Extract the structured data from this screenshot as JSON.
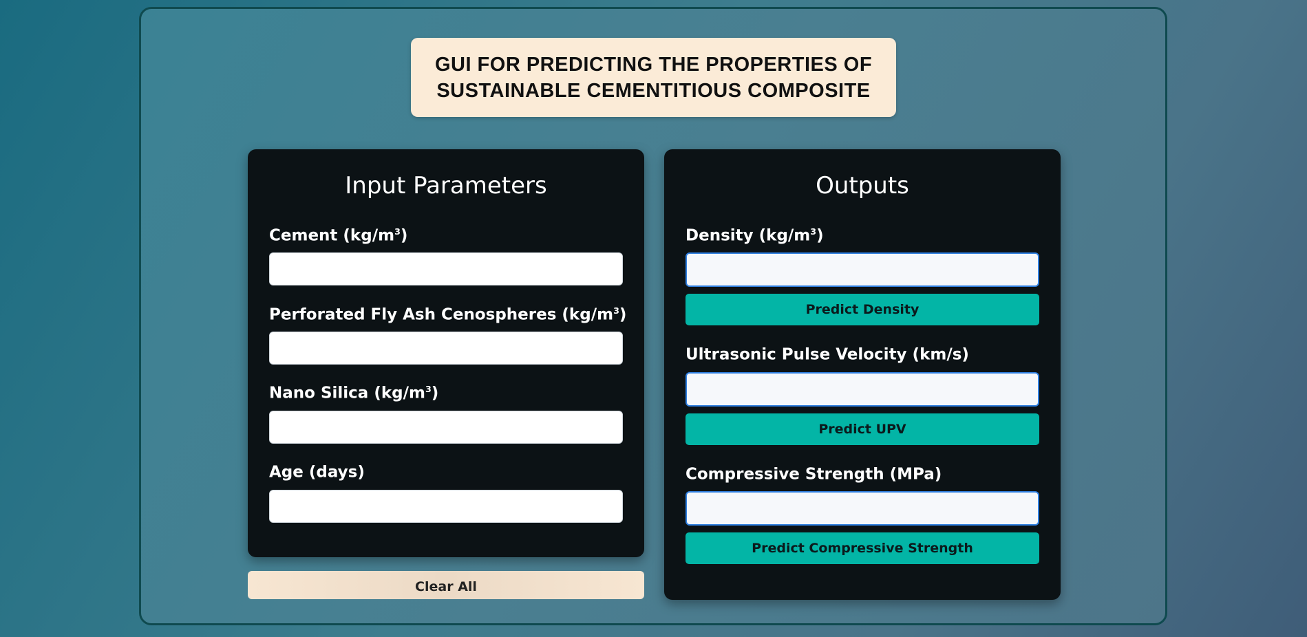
{
  "header": {
    "title": "GUI FOR PREDICTING THE PROPERTIES OF\nSUSTAINABLE CEMENTITIOUS COMPOSITE"
  },
  "input_panel": {
    "heading": "Input Parameters",
    "fields": [
      {
        "label_main": "Cement (kg/m",
        "label_sup": "3",
        "label_end": ")",
        "value": ""
      },
      {
        "label_main": "Perforated Fly Ash Cenospheres (kg/m",
        "label_sup": "3",
        "label_end": ")",
        "value": ""
      },
      {
        "label_main": "Nano Silica (kg/m",
        "label_sup": "3",
        "label_end": ")",
        "value": ""
      },
      {
        "label_main": "Age (days)",
        "label_sup": "",
        "label_end": "",
        "value": ""
      }
    ]
  },
  "output_panel": {
    "heading": "Outputs",
    "fields": [
      {
        "label_main": "Density (kg/m",
        "label_sup": "3",
        "label_end": ")",
        "value": "",
        "button": "Predict Density"
      },
      {
        "label_main": "Ultrasonic Pulse Velocity (km/s)",
        "label_sup": "",
        "label_end": "",
        "value": "",
        "button": "Predict UPV"
      },
      {
        "label_main": "Compressive Strength (MPa)",
        "label_sup": "",
        "label_end": "",
        "value": "",
        "button": "Predict Compressive Strength"
      }
    ]
  },
  "actions": {
    "clear_label": "Clear All"
  },
  "colors": {
    "accent_button": "#03b5a6",
    "panel_bg": "#0c1215",
    "title_bg": "#fbebd7",
    "focus_border": "#2f7fe0"
  }
}
